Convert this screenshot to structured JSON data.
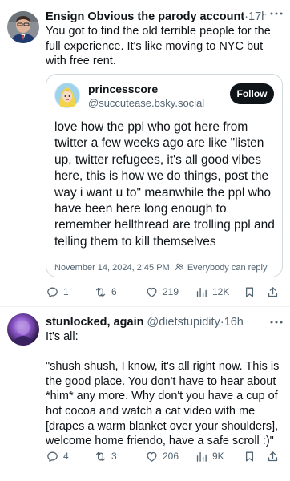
{
  "posts": [
    {
      "author": "Ensign Obvious the parody account",
      "separator": "·",
      "time": "17h",
      "text": "You got to find the old terrible people for the full experience. It's like moving to NYC but with free rent.",
      "quote": {
        "name": "princesscore",
        "handle": "@succutease.bsky.social",
        "follow_label": "Follow",
        "text": "love how the ppl who got here from twitter a few weeks ago are like \"listen up, twitter refugees, it's all good vibes here, this is how we do things, post the way i want u to\" meanwhile the ppl who have been here long enough to remember hellthread are trolling ppl and telling them to kill themselves",
        "date": "November 14, 2024, 2:45 PM",
        "reply_setting": "Everybody can reply"
      },
      "stats": {
        "replies": "1",
        "reposts": "6",
        "likes": "219",
        "views": "12K"
      }
    },
    {
      "author": "stunlocked, again",
      "handle": "@dietstupidity",
      "separator": "·",
      "time": "16h",
      "text": "It's all:\n\n\"shush shush, I know, it's all right now. This is the good place. You don't have to hear about *him* any more. Why don't you have a cup of hot cocoa and watch a cat video with me [drapes a warm blanket over your shoulders], welcome home friendo, have a safe scroll :)\"",
      "stats": {
        "replies": "4",
        "reposts": "3",
        "likes": "206",
        "views": "9K"
      }
    }
  ],
  "colors": {
    "text": "#0f1419",
    "secondary": "#536471",
    "border": "#cfd9de",
    "divider": "#eff3f4",
    "button": "#0f1419"
  },
  "icons": [
    "more-icon",
    "reply-icon",
    "repost-icon",
    "like-icon",
    "views-icon",
    "bookmark-icon",
    "share-icon",
    "people-icon"
  ]
}
